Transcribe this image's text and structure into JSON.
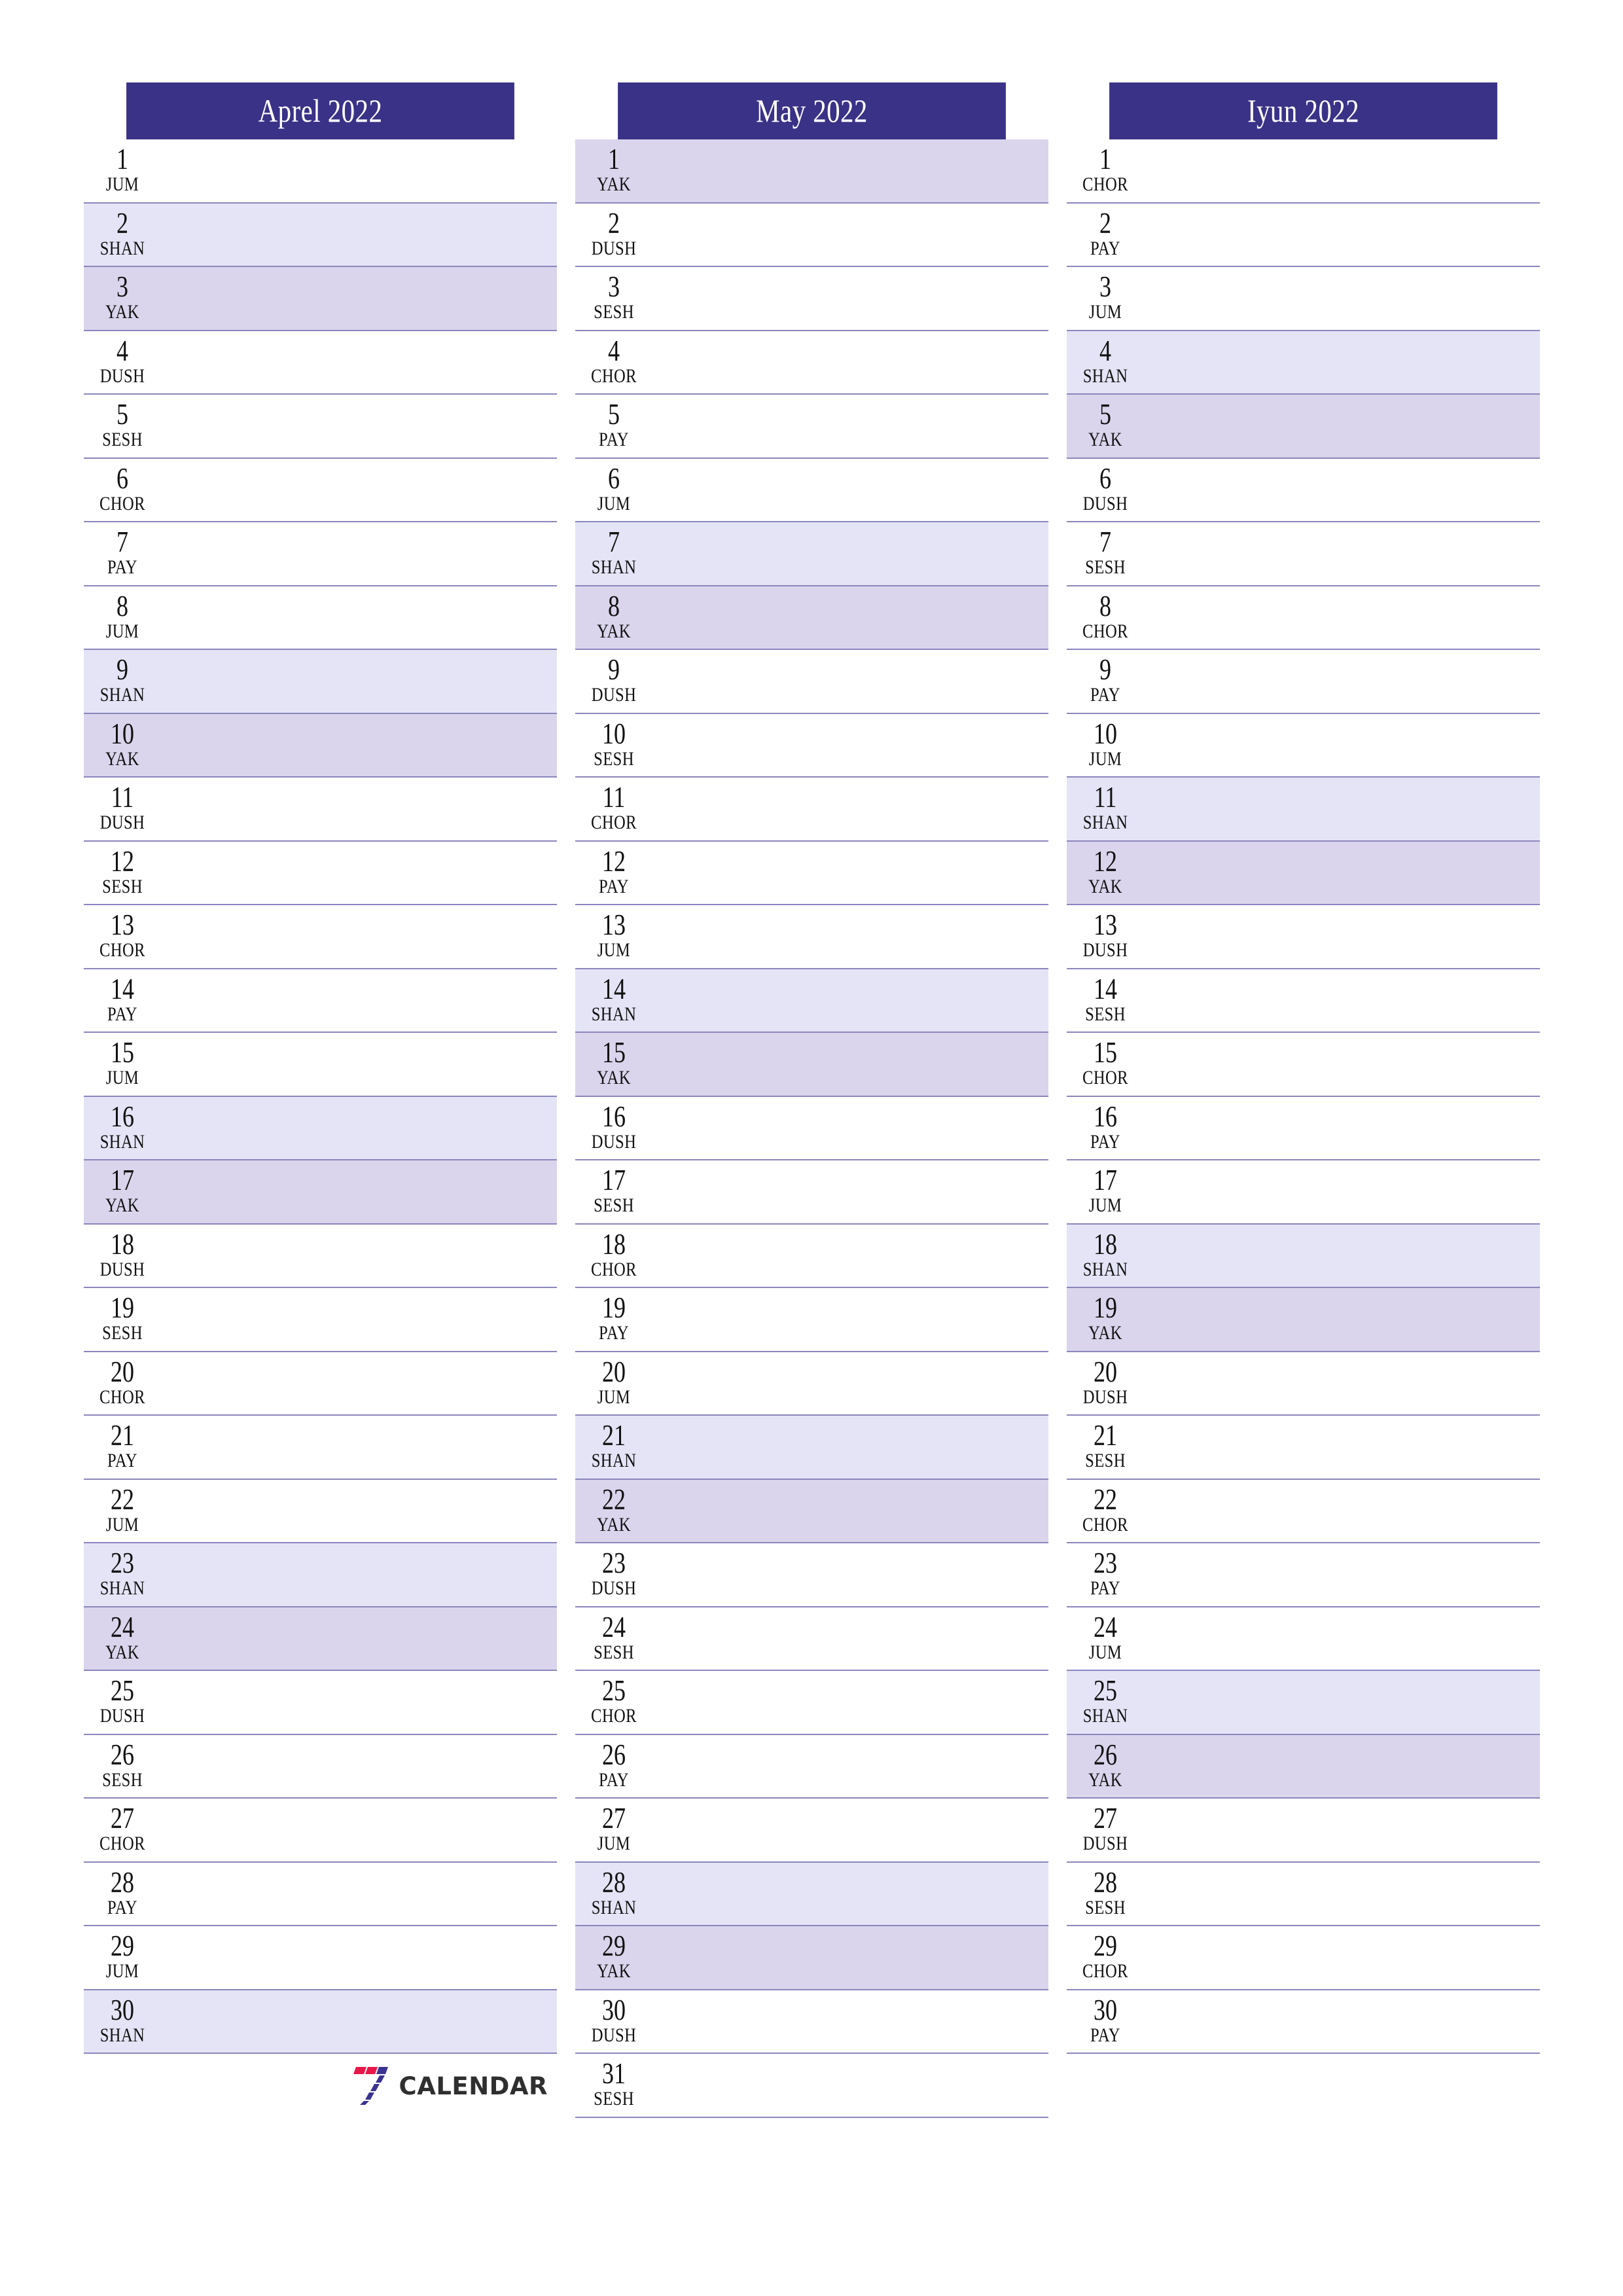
{
  "document": {
    "type": "three-month-calendar-planner",
    "year": "2022",
    "brand_name": "CALENDAR",
    "brand_mark": "seven-logo-icon"
  },
  "colors": {
    "header_background": "#3a3287",
    "header_text": "#ffffff",
    "saturday_row": "#e4e4f6",
    "sunday_row": "#dad5ec",
    "row_divider": "#8b86bd",
    "day_text": "#111111",
    "logo_red": "#e8174a",
    "logo_blue": "#3b3391",
    "logo_wordmark": "#2f2f2f"
  },
  "weekday_codes": {
    "monday": "DUSH",
    "tuesday": "SESH",
    "wednesday": "CHOR",
    "thursday": "PAY",
    "friday": "JUM",
    "saturday": "SHAN",
    "sunday": "YAK"
  },
  "months": [
    {
      "title": "Aprel 2022",
      "name": "Aprel",
      "year": "2022",
      "day_count": 30,
      "show_logo": true,
      "days": [
        {
          "num": "1",
          "abbr": "JUM",
          "type": "weekday"
        },
        {
          "num": "2",
          "abbr": "SHAN",
          "type": "saturday"
        },
        {
          "num": "3",
          "abbr": "YAK",
          "type": "sunday"
        },
        {
          "num": "4",
          "abbr": "DUSH",
          "type": "weekday"
        },
        {
          "num": "5",
          "abbr": "SESH",
          "type": "weekday"
        },
        {
          "num": "6",
          "abbr": "CHOR",
          "type": "weekday"
        },
        {
          "num": "7",
          "abbr": "PAY",
          "type": "weekday"
        },
        {
          "num": "8",
          "abbr": "JUM",
          "type": "weekday"
        },
        {
          "num": "9",
          "abbr": "SHAN",
          "type": "saturday"
        },
        {
          "num": "10",
          "abbr": "YAK",
          "type": "sunday"
        },
        {
          "num": "11",
          "abbr": "DUSH",
          "type": "weekday"
        },
        {
          "num": "12",
          "abbr": "SESH",
          "type": "weekday"
        },
        {
          "num": "13",
          "abbr": "CHOR",
          "type": "weekday"
        },
        {
          "num": "14",
          "abbr": "PAY",
          "type": "weekday"
        },
        {
          "num": "15",
          "abbr": "JUM",
          "type": "weekday"
        },
        {
          "num": "16",
          "abbr": "SHAN",
          "type": "saturday"
        },
        {
          "num": "17",
          "abbr": "YAK",
          "type": "sunday"
        },
        {
          "num": "18",
          "abbr": "DUSH",
          "type": "weekday"
        },
        {
          "num": "19",
          "abbr": "SESH",
          "type": "weekday"
        },
        {
          "num": "20",
          "abbr": "CHOR",
          "type": "weekday"
        },
        {
          "num": "21",
          "abbr": "PAY",
          "type": "weekday"
        },
        {
          "num": "22",
          "abbr": "JUM",
          "type": "weekday"
        },
        {
          "num": "23",
          "abbr": "SHAN",
          "type": "saturday"
        },
        {
          "num": "24",
          "abbr": "YAK",
          "type": "sunday"
        },
        {
          "num": "25",
          "abbr": "DUSH",
          "type": "weekday"
        },
        {
          "num": "26",
          "abbr": "SESH",
          "type": "weekday"
        },
        {
          "num": "27",
          "abbr": "CHOR",
          "type": "weekday"
        },
        {
          "num": "28",
          "abbr": "PAY",
          "type": "weekday"
        },
        {
          "num": "29",
          "abbr": "JUM",
          "type": "weekday"
        },
        {
          "num": "30",
          "abbr": "SHAN",
          "type": "saturday"
        }
      ]
    },
    {
      "title": "May 2022",
      "name": "May",
      "year": "2022",
      "day_count": 31,
      "show_logo": false,
      "days": [
        {
          "num": "1",
          "abbr": "YAK",
          "type": "sunday"
        },
        {
          "num": "2",
          "abbr": "DUSH",
          "type": "weekday"
        },
        {
          "num": "3",
          "abbr": "SESH",
          "type": "weekday"
        },
        {
          "num": "4",
          "abbr": "CHOR",
          "type": "weekday"
        },
        {
          "num": "5",
          "abbr": "PAY",
          "type": "weekday"
        },
        {
          "num": "6",
          "abbr": "JUM",
          "type": "weekday"
        },
        {
          "num": "7",
          "abbr": "SHAN",
          "type": "saturday"
        },
        {
          "num": "8",
          "abbr": "YAK",
          "type": "sunday"
        },
        {
          "num": "9",
          "abbr": "DUSH",
          "type": "weekday"
        },
        {
          "num": "10",
          "abbr": "SESH",
          "type": "weekday"
        },
        {
          "num": "11",
          "abbr": "CHOR",
          "type": "weekday"
        },
        {
          "num": "12",
          "abbr": "PAY",
          "type": "weekday"
        },
        {
          "num": "13",
          "abbr": "JUM",
          "type": "weekday"
        },
        {
          "num": "14",
          "abbr": "SHAN",
          "type": "saturday"
        },
        {
          "num": "15",
          "abbr": "YAK",
          "type": "sunday"
        },
        {
          "num": "16",
          "abbr": "DUSH",
          "type": "weekday"
        },
        {
          "num": "17",
          "abbr": "SESH",
          "type": "weekday"
        },
        {
          "num": "18",
          "abbr": "CHOR",
          "type": "weekday"
        },
        {
          "num": "19",
          "abbr": "PAY",
          "type": "weekday"
        },
        {
          "num": "20",
          "abbr": "JUM",
          "type": "weekday"
        },
        {
          "num": "21",
          "abbr": "SHAN",
          "type": "saturday"
        },
        {
          "num": "22",
          "abbr": "YAK",
          "type": "sunday"
        },
        {
          "num": "23",
          "abbr": "DUSH",
          "type": "weekday"
        },
        {
          "num": "24",
          "abbr": "SESH",
          "type": "weekday"
        },
        {
          "num": "25",
          "abbr": "CHOR",
          "type": "weekday"
        },
        {
          "num": "26",
          "abbr": "PAY",
          "type": "weekday"
        },
        {
          "num": "27",
          "abbr": "JUM",
          "type": "weekday"
        },
        {
          "num": "28",
          "abbr": "SHAN",
          "type": "saturday"
        },
        {
          "num": "29",
          "abbr": "YAK",
          "type": "sunday"
        },
        {
          "num": "30",
          "abbr": "DUSH",
          "type": "weekday"
        },
        {
          "num": "31",
          "abbr": "SESH",
          "type": "weekday"
        }
      ]
    },
    {
      "title": "Iyun 2022",
      "name": "Iyun",
      "year": "2022",
      "day_count": 30,
      "show_logo": false,
      "days": [
        {
          "num": "1",
          "abbr": "CHOR",
          "type": "weekday"
        },
        {
          "num": "2",
          "abbr": "PAY",
          "type": "weekday"
        },
        {
          "num": "3",
          "abbr": "JUM",
          "type": "weekday"
        },
        {
          "num": "4",
          "abbr": "SHAN",
          "type": "saturday"
        },
        {
          "num": "5",
          "abbr": "YAK",
          "type": "sunday"
        },
        {
          "num": "6",
          "abbr": "DUSH",
          "type": "weekday"
        },
        {
          "num": "7",
          "abbr": "SESH",
          "type": "weekday"
        },
        {
          "num": "8",
          "abbr": "CHOR",
          "type": "weekday"
        },
        {
          "num": "9",
          "abbr": "PAY",
          "type": "weekday"
        },
        {
          "num": "10",
          "abbr": "JUM",
          "type": "weekday"
        },
        {
          "num": "11",
          "abbr": "SHAN",
          "type": "saturday"
        },
        {
          "num": "12",
          "abbr": "YAK",
          "type": "sunday"
        },
        {
          "num": "13",
          "abbr": "DUSH",
          "type": "weekday"
        },
        {
          "num": "14",
          "abbr": "SESH",
          "type": "weekday"
        },
        {
          "num": "15",
          "abbr": "CHOR",
          "type": "weekday"
        },
        {
          "num": "16",
          "abbr": "PAY",
          "type": "weekday"
        },
        {
          "num": "17",
          "abbr": "JUM",
          "type": "weekday"
        },
        {
          "num": "18",
          "abbr": "SHAN",
          "type": "saturday"
        },
        {
          "num": "19",
          "abbr": "YAK",
          "type": "sunday"
        },
        {
          "num": "20",
          "abbr": "DUSH",
          "type": "weekday"
        },
        {
          "num": "21",
          "abbr": "SESH",
          "type": "weekday"
        },
        {
          "num": "22",
          "abbr": "CHOR",
          "type": "weekday"
        },
        {
          "num": "23",
          "abbr": "PAY",
          "type": "weekday"
        },
        {
          "num": "24",
          "abbr": "JUM",
          "type": "weekday"
        },
        {
          "num": "25",
          "abbr": "SHAN",
          "type": "saturday"
        },
        {
          "num": "26",
          "abbr": "YAK",
          "type": "sunday"
        },
        {
          "num": "27",
          "abbr": "DUSH",
          "type": "weekday"
        },
        {
          "num": "28",
          "abbr": "SESH",
          "type": "weekday"
        },
        {
          "num": "29",
          "abbr": "CHOR",
          "type": "weekday"
        },
        {
          "num": "30",
          "abbr": "PAY",
          "type": "weekday"
        }
      ]
    }
  ]
}
